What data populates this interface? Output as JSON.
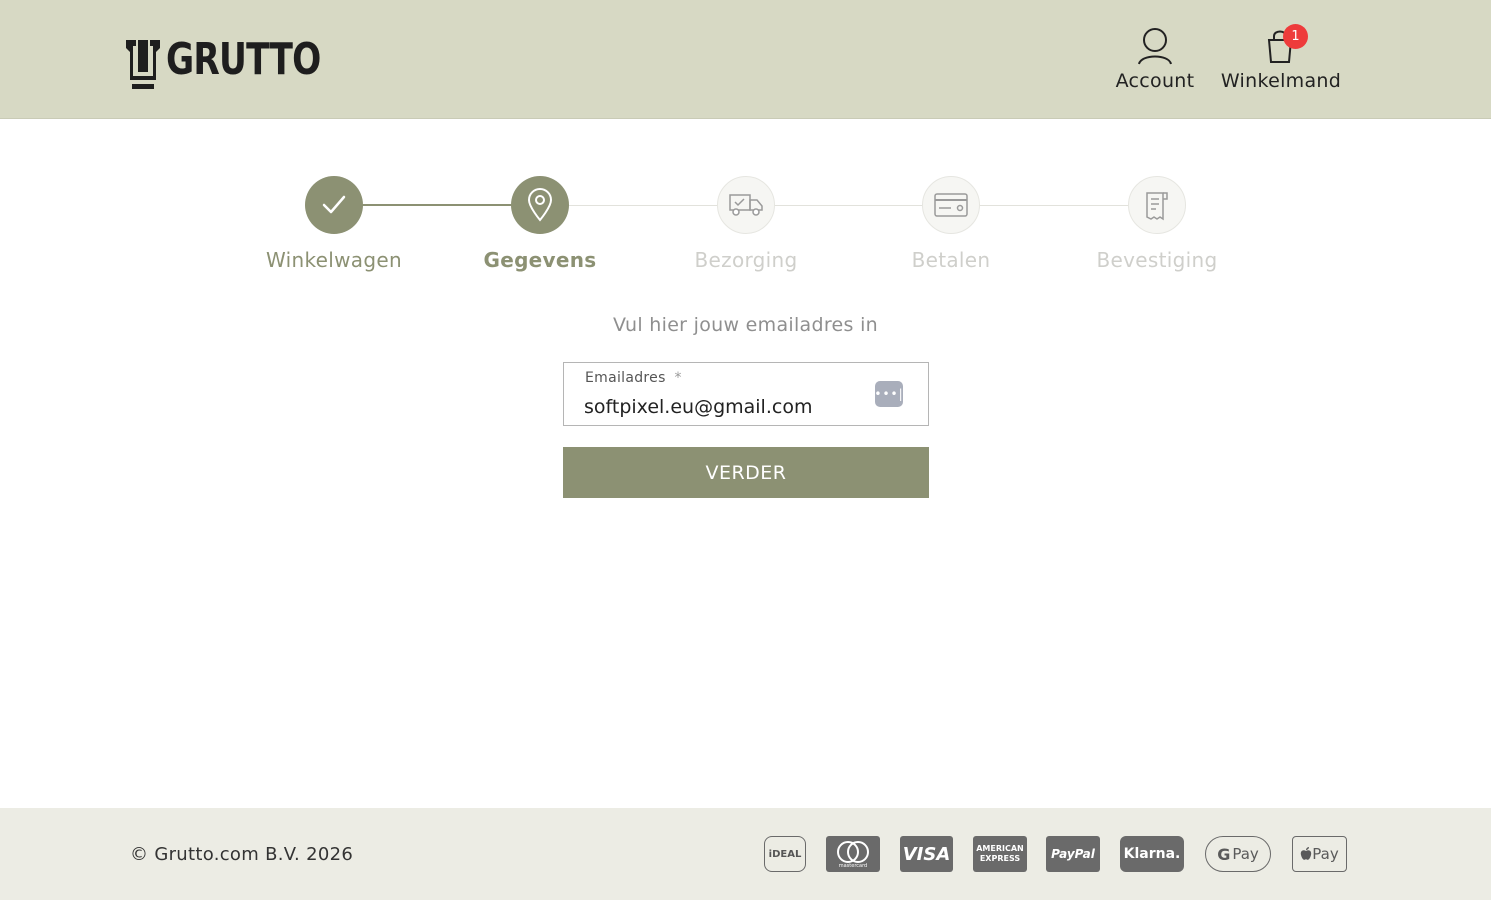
{
  "header": {
    "brand": "GRUTTO",
    "account_label": "Account",
    "cart_label": "Winkelmand",
    "cart_count": "1"
  },
  "stepper": {
    "steps": [
      {
        "label": "Winkelwagen",
        "state": "done",
        "icon": "check-icon"
      },
      {
        "label": "Gegevens",
        "state": "current",
        "icon": "location-pin-icon"
      },
      {
        "label": "Bezorging",
        "state": "future",
        "icon": "delivery-truck-icon"
      },
      {
        "label": "Betalen",
        "state": "future",
        "icon": "credit-card-icon"
      },
      {
        "label": "Bevestiging",
        "state": "future",
        "icon": "receipt-icon"
      }
    ]
  },
  "form": {
    "prompt": "Vul hier jouw emailadres in",
    "email_label": "Emailadres",
    "required_marker": "*",
    "email_value": "softpixel.eu@gmail.com",
    "submit_label": "VERDER"
  },
  "footer": {
    "copyright": "© Grutto.com B.V. 2026",
    "payments": {
      "ideal": "iDEAL",
      "mastercard": "mastercard",
      "visa": "VISA",
      "amex_line1": "AMERICAN",
      "amex_line2": "EXPRESS",
      "paypal": "PayPal",
      "klarna": "Klarna.",
      "gpay": "Pay",
      "applepay": "Pay"
    }
  },
  "colors": {
    "header_bg": "#d7d9c4",
    "accent": "#8c9173",
    "badge": "#ee3b3b",
    "footer_bg": "#ecece4"
  }
}
